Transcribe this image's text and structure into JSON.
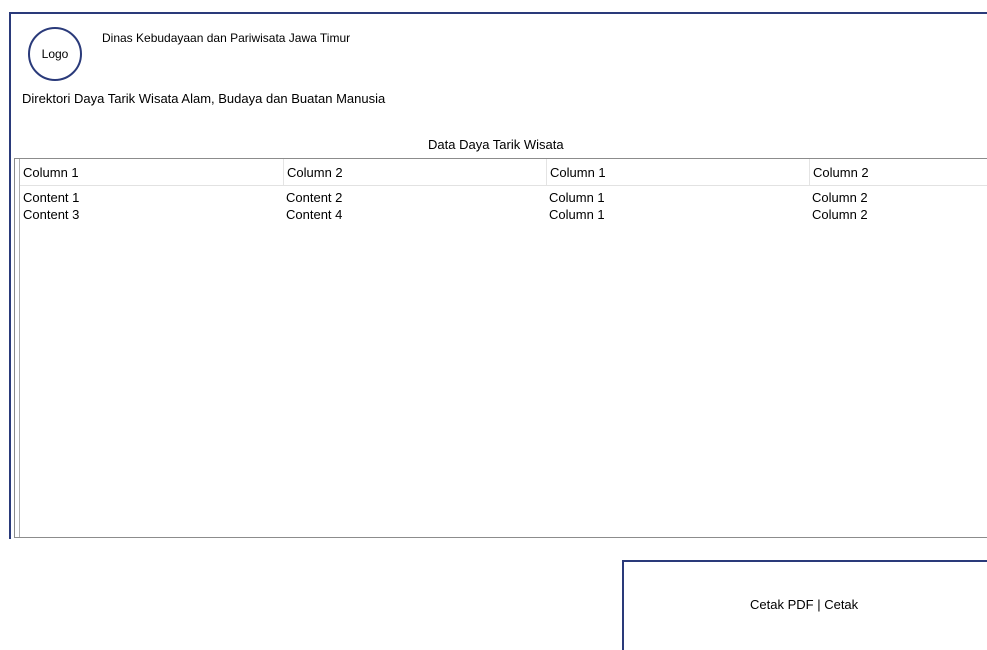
{
  "header": {
    "logo_text": "Logo",
    "org_name": "Dinas Kebudayaan dan Pariwisata Jawa Timur",
    "subtitle": "Direktori Daya Tarik Wisata Alam, Budaya dan Buatan Manusia"
  },
  "table": {
    "caption": "Data Daya Tarik Wisata",
    "columns": [
      "Column 1",
      "Column 2",
      "Column 1",
      "Column 2"
    ],
    "rows": [
      [
        "Content 1",
        "Content 2",
        "Column 1",
        "Column 2"
      ],
      [
        "Content 3",
        "Content 4",
        "Column 1",
        "Column 2"
      ]
    ]
  },
  "footer": {
    "pdf_label": "Cetak PDF",
    "separator": "|",
    "print_label": "Cetak"
  },
  "colors": {
    "frame_border": "#2a3a7a",
    "table_border": "#8c8c8c"
  }
}
